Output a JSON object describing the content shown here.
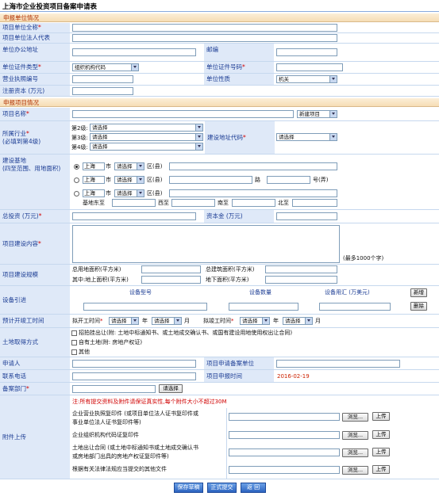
{
  "title": "上海市企业投资项目备案申请表",
  "sections": {
    "unit": "申报单位情况",
    "project": "申报项目情况"
  },
  "labels": {
    "unit_name": "项目单位全称",
    "legal_rep": "项目单位法人代表",
    "office_addr": "单位办公地址",
    "postcode": "邮编",
    "cert_type": "单位证件类型",
    "cert_no": "单位证件号码",
    "license_no": "营业执照编号",
    "unit_nature": "单位性质",
    "reg_capital": "注册资本 (万元)",
    "project_name": "项目名称",
    "industry_1": "所属行业",
    "industry_2": "(必填到第4级)",
    "build_addr_code": "建设地址代码",
    "build_base_1": "建设基地",
    "build_base_2": "(四至范围、用地面积)",
    "total_invest": "总投资 (万元)",
    "capital": "资本金 (万元)",
    "content": "项目建设内容",
    "scale": "项目建设规模",
    "equipment": "设备引进",
    "schedule": "预计开竣工时间",
    "land": "土地取得方式",
    "applicant": "申请人",
    "filing_unit": "项目申请备案单位",
    "phone": "联系电话",
    "apply_time": "项目申报时间",
    "filing_dept": "备案部门",
    "attachments": "附件上传"
  },
  "required_mark": "*",
  "selects": {
    "cert_type": "组织机构代码",
    "unit_nature": "机关",
    "project_type": "新建项目",
    "please_choose": "请选择"
  },
  "industry_levels": [
    "第2级:",
    "第3级:",
    "第4级:"
  ],
  "address": {
    "city": "上海",
    "city_suffix": "市",
    "district_suffix": "区(县)",
    "road_suffix": "路",
    "no_suffix": "号(弄)",
    "east": "基地东至",
    "west": "西至",
    "south": "南至",
    "north": "北至"
  },
  "content_hint": "(最多1000个字)",
  "scale_fields": {
    "land_area": "总用地面积(平方米)",
    "floor_area": "总建筑面积(平方米)",
    "above_area": "其中:地上面积(平方米)",
    "under_area": "地下面积(平方米)"
  },
  "equipment": {
    "col_model": "设备型号",
    "col_qty": "设备数量",
    "col_fx": "设备用汇 (万美元)",
    "add": "新增",
    "delete": "删除"
  },
  "schedule": {
    "start": "拟开工时间",
    "end": "拟竣工时间",
    "year": "年",
    "month": "月"
  },
  "land_options": [
    "招拍挂出让(附: 土地中标通知书、或土地成交确认书、或国有建设用地使用权出让合同)",
    "自有土地(附: 房地产权证)",
    "其他"
  ],
  "apply_date": "2016-02-19",
  "choose_button": "请选择",
  "attach_note": "注:所有提交资料及附件请保证真实性,每个附件大小不超过30M",
  "attach_items": [
    [
      "企业营业执照复印件 (或项目单位法人证书复印件或",
      "事业单位法人证书复印件等)"
    ],
    [
      "企业组织机构代码证复印件"
    ],
    [
      "土地出让合同 (或土地中标通知书或土地成交确认书",
      "或房地部门出具的房地产权证复印件等)"
    ],
    [
      "根据有关法律法规应当提交的其他文件"
    ]
  ],
  "browse": "浏览...",
  "upload": "上传",
  "footer": {
    "save": "保存草稿",
    "submit": "正式提交",
    "back": "返 回"
  }
}
